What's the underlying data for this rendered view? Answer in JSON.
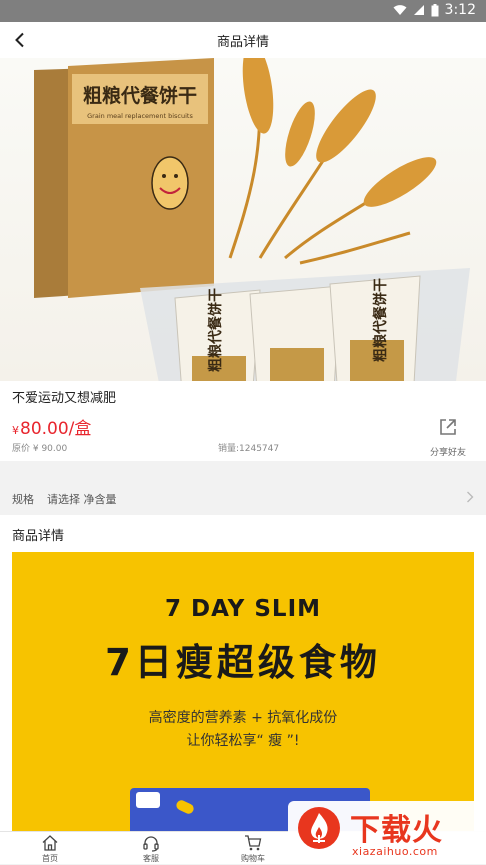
{
  "status": {
    "time": "3:12"
  },
  "nav": {
    "title": "商品详情"
  },
  "hero": {
    "box_title": "粗粮代餐饼干",
    "box_subtitle": "Grain meal replacement biscuits",
    "pack_text": "粗粮代餐饼干"
  },
  "product": {
    "name": "不爱运动又想减肥",
    "currency": "¥",
    "price": "80.00/盒",
    "original_price": "原价 ¥ 90.00",
    "sales": "销量:1245747",
    "share_label": "分享好友"
  },
  "spec": {
    "label": "规格",
    "value": "请选择 净含量"
  },
  "detail": {
    "heading": "商品详情",
    "poster_en": "7 DAY SLIM",
    "poster_cn": "7日瘦超级食物",
    "poster_line1": "高密度的营养素 + 抗氧化成份",
    "poster_line2": "让你轻松享“ 瘦 ”!"
  },
  "tabs": [
    {
      "label": "首页",
      "icon": "home-icon"
    },
    {
      "label": "客服",
      "icon": "headset-icon"
    },
    {
      "label": "购物车",
      "icon": "cart-icon"
    }
  ],
  "watermark": {
    "brand": "下载火",
    "url": "xiazaihuo.com"
  },
  "colors": {
    "price_red": "#e8262e",
    "poster_yellow": "#f7c300",
    "status_bar": "#7f7f7f",
    "watermark_red": "#e8361e"
  }
}
